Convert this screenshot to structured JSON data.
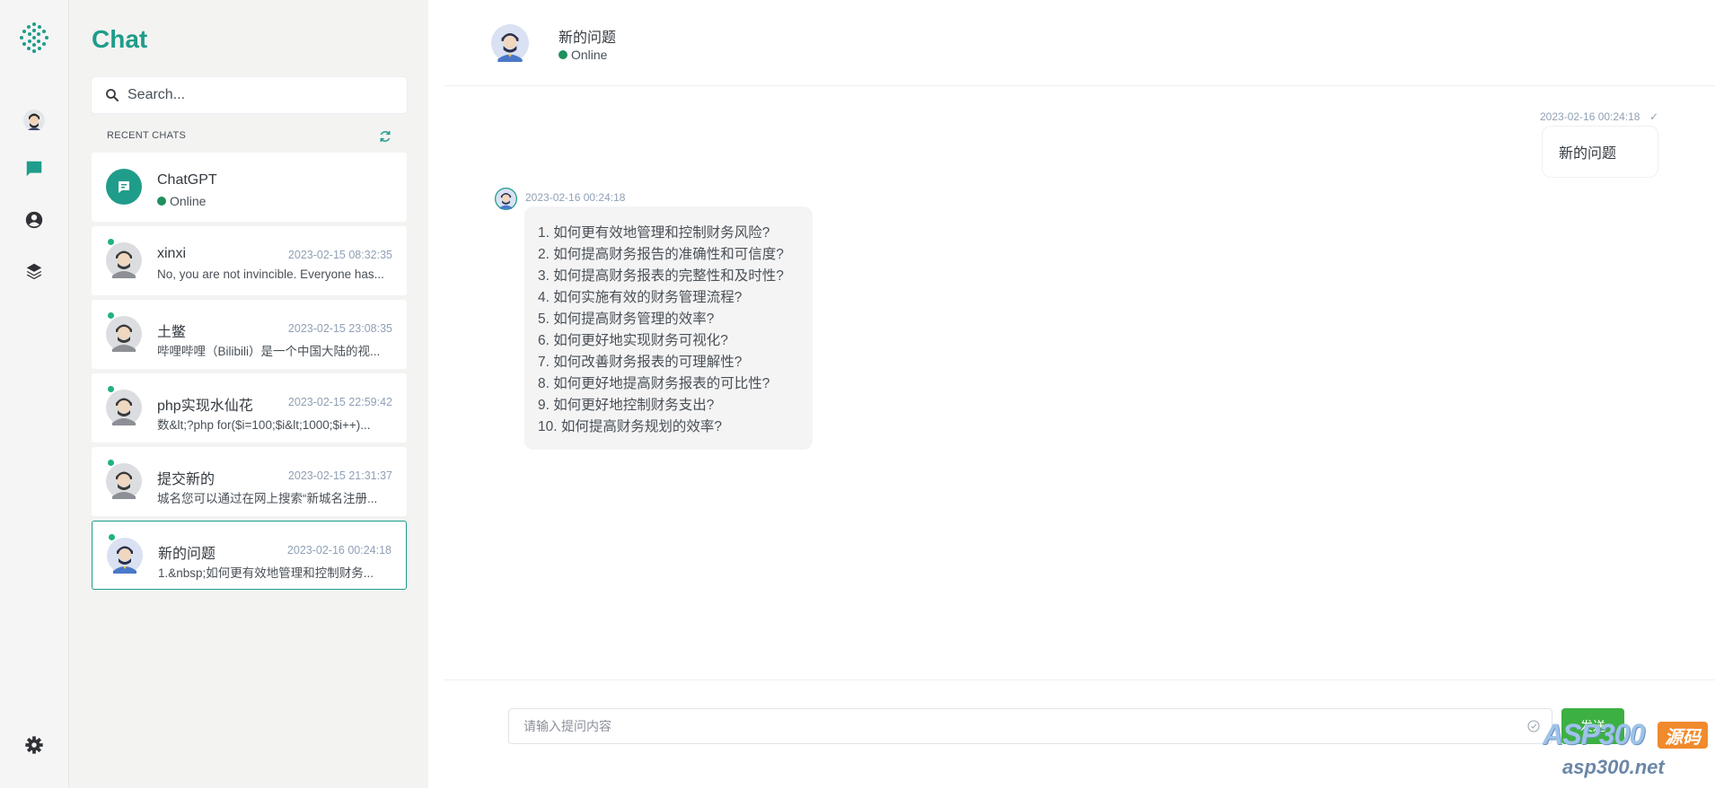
{
  "sidebar": {
    "title": "Chat",
    "search_placeholder": "Search...",
    "recent_heading": "RECENT CHATS",
    "items": [
      {
        "name": "ChatGPT",
        "status": "Online",
        "time": "",
        "preview": ""
      },
      {
        "name": "xinxi",
        "time": "2023-02-15 08:32:35",
        "preview": "No, you are not invincible. Everyone has..."
      },
      {
        "name": "土鳖",
        "time": "2023-02-15 23:08:35",
        "preview": "哔哩哔哩（Bilibili）是一个中国大陆的视..."
      },
      {
        "name": "php实现水仙花",
        "time": "2023-02-15 22:59:42",
        "preview": "数&lt;?php for($i=100;$i&lt;1000;$i++)..."
      },
      {
        "name": "提交新的",
        "time": "2023-02-15 21:31:37",
        "preview": "城名您可以通过在网上搜索“新城名注册..."
      },
      {
        "name": "新的问题",
        "time": "2023-02-16 00:24:18",
        "preview": "1.&nbsp;如何更有效地管理和控制财务..."
      }
    ]
  },
  "header": {
    "name": "新的问题",
    "status": "Online"
  },
  "messages": {
    "outgoing": {
      "time": "2023-02-16 00:24:18",
      "check": "✓",
      "text": "新的问题"
    },
    "incoming": {
      "time": "2023-02-16 00:24:18",
      "lines": [
        "1. 如何更有效地管理和控制财务风险?",
        "2. 如何提高财务报告的准确性和可信度?",
        "3. 如何提高财务报表的完整性和及时性?",
        "4. 如何实施有效的财务管理流程?",
        "5. 如何提高财务管理的效率?",
        "6. 如何更好地实现财务可视化?",
        "7. 如何改善财务报表的可理解性?",
        "8. 如何更好地提高财务报表的可比性?",
        "9. 如何更好地控制财务支出?",
        "10. 如何提高财务规划的效率?"
      ]
    }
  },
  "composer": {
    "placeholder": "请输入提问内容",
    "send_label": "发送"
  },
  "watermark": {
    "brand": "ASP300",
    "code": "源码",
    "url": "asp300.net"
  },
  "colors": {
    "accent": "#1f9d8a",
    "online": "#1e8f5e",
    "send": "#3cb043"
  },
  "icons": {
    "rail": [
      "logo-dots-icon",
      "profile-avatar-icon",
      "chat-icon",
      "user-circle-icon",
      "layers-icon",
      "settings-gear-icon"
    ]
  }
}
